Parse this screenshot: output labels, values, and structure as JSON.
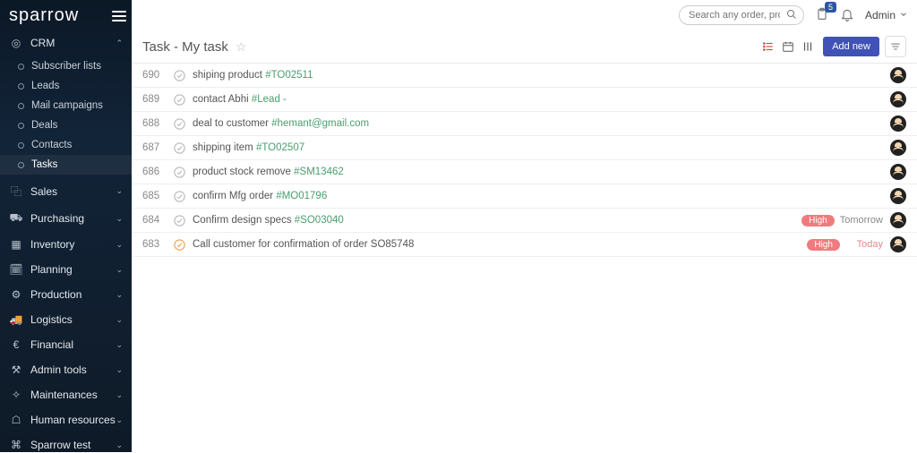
{
  "brand": "sparrow",
  "search": {
    "placeholder": "Search any order, products.."
  },
  "notif_badge": "5",
  "user": {
    "name": "Admin"
  },
  "page": {
    "title": "Task - My task",
    "add_btn": "Add new"
  },
  "sidebar": {
    "sections": [
      {
        "label": "CRM",
        "icon": "◎",
        "expanded": true,
        "items": [
          {
            "label": "Subscriber lists"
          },
          {
            "label": "Leads"
          },
          {
            "label": "Mail campaigns"
          },
          {
            "label": "Deals"
          },
          {
            "label": "Contacts"
          },
          {
            "label": "Tasks",
            "active": true
          }
        ]
      },
      {
        "label": "Sales",
        "icon": "⿻"
      },
      {
        "label": "Purchasing",
        "icon": "⛟"
      },
      {
        "label": "Inventory",
        "icon": "▦"
      },
      {
        "label": "Planning",
        "icon": "🗓"
      },
      {
        "label": "Production",
        "icon": "⚙"
      },
      {
        "label": "Logistics",
        "icon": "🚚"
      },
      {
        "label": "Financial",
        "icon": "€"
      },
      {
        "label": "Admin tools",
        "icon": "⚒"
      },
      {
        "label": "Maintenances",
        "icon": "✧"
      },
      {
        "label": "Human resources",
        "icon": "☖"
      },
      {
        "label": "Sparrow test",
        "icon": "⌘"
      }
    ]
  },
  "tasks": [
    {
      "num": "690",
      "text": "shiping product ",
      "link": "#TO02511"
    },
    {
      "num": "689",
      "text": "contact Abhi ",
      "link": "#Lead -"
    },
    {
      "num": "688",
      "text": "deal to customer ",
      "link": "#hemant@gmail.com"
    },
    {
      "num": "687",
      "text": "shipping item ",
      "link": "#TO02507"
    },
    {
      "num": "686",
      "text": "product stock remove ",
      "link": "#SM13462"
    },
    {
      "num": "685",
      "text": "confirm Mfg order ",
      "link": "#MO01796"
    },
    {
      "num": "684",
      "text": "Confirm design specs ",
      "link": "#SO03040",
      "priority": "High",
      "due": "Tomorrow"
    },
    {
      "num": "683",
      "text": "Call customer for confirmation of order SO85748",
      "link": "",
      "priority": "High",
      "due": "Today",
      "pending": true
    }
  ]
}
